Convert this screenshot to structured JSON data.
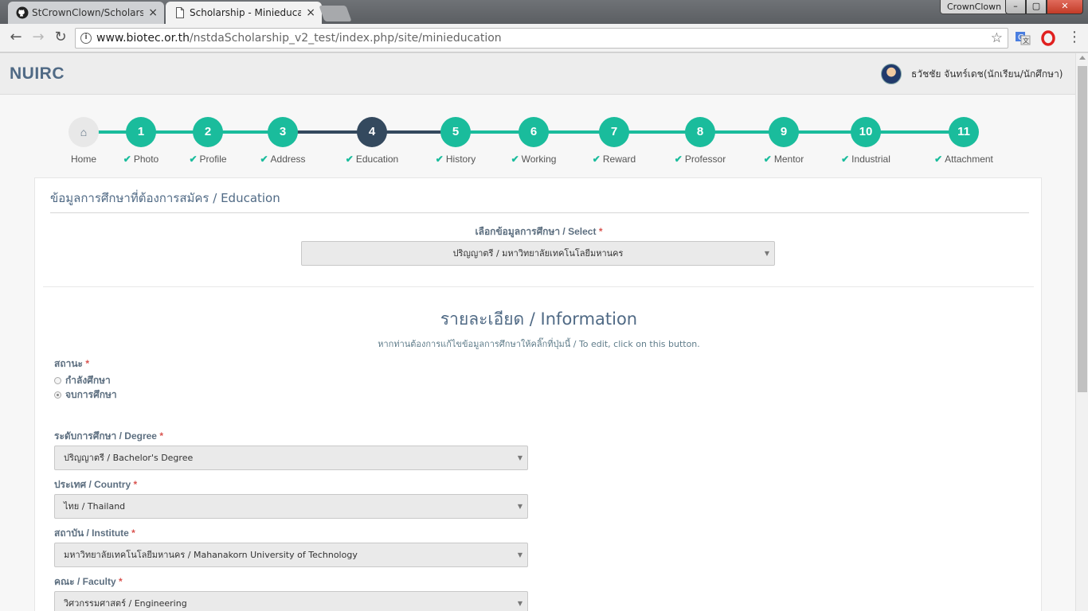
{
  "browser": {
    "tabs": [
      {
        "label": "StCrownClown/Scholarsh",
        "close": "×"
      },
      {
        "label": "Scholarship - Minieducati",
        "close": "×"
      }
    ],
    "profile_name": "CrownClown",
    "window_buttons": {
      "minimize": "–",
      "maximize": "▢",
      "close": "✕"
    },
    "url_host": "www.biotec.or.th",
    "url_path": "/nstdaScholarship_v2_test/index.php/site/minieducation"
  },
  "header": {
    "brand": "NUIRC",
    "user_name": "ธวัชชัย จันทร์เดช(นักเรียน/นักศึกษา)"
  },
  "wizard": {
    "steps": [
      {
        "number": "⌂",
        "label": "Home"
      },
      {
        "number": "1",
        "label": "Photo"
      },
      {
        "number": "2",
        "label": "Profile"
      },
      {
        "number": "3",
        "label": "Address"
      },
      {
        "number": "4",
        "label": "Education"
      },
      {
        "number": "5",
        "label": "History"
      },
      {
        "number": "6",
        "label": "Working"
      },
      {
        "number": "7",
        "label": "Reward"
      },
      {
        "number": "8",
        "label": "Professor"
      },
      {
        "number": "9",
        "label": "Mentor"
      },
      {
        "number": "10",
        "label": "Industrial"
      },
      {
        "number": "11",
        "label": "Attachment"
      }
    ],
    "current_step": "4",
    "check": "✔"
  },
  "panel": {
    "title": "ข้อมูลการศึกษาที่ต้องการสมัคร / Education",
    "select_label": "เลือกข้อมูลการศึกษา / Select",
    "select_value": "ปริญญาตรี / มหาวิทยาลัยเทคโนโลยีมหานคร",
    "info_title": "รายละเอียด / Information",
    "info_sub": "หากท่านต้องการแก้ไขข้อมูลการศึกษาให้คลิ๊กที่ปุ่มนี้ / To edit, click on this button.",
    "status_label": "สถานะ",
    "status_options": [
      "กำลังศึกษา",
      "จบการศึกษา"
    ],
    "status_selected": "จบการศึกษา",
    "required_mark": "*",
    "fields": [
      {
        "label": "ระดับการศึกษา / Degree",
        "value": "ปริญญาตรี / Bachelor's Degree"
      },
      {
        "label": "ประเทศ / Country",
        "value": "ไทย / Thailand"
      },
      {
        "label": "สถาบัน / Institute",
        "value": "มหาวิทยาลัยเทคโนโลยีมหานคร / Mahanakorn University of Technology"
      },
      {
        "label": "คณะ / Faculty",
        "value": "วิศวกรรมศาสตร์ / Engineering"
      }
    ]
  },
  "colors": {
    "accent": "#1abc9c",
    "current_step": "#34495e",
    "brand": "#506a85",
    "required": "#d9534f"
  }
}
